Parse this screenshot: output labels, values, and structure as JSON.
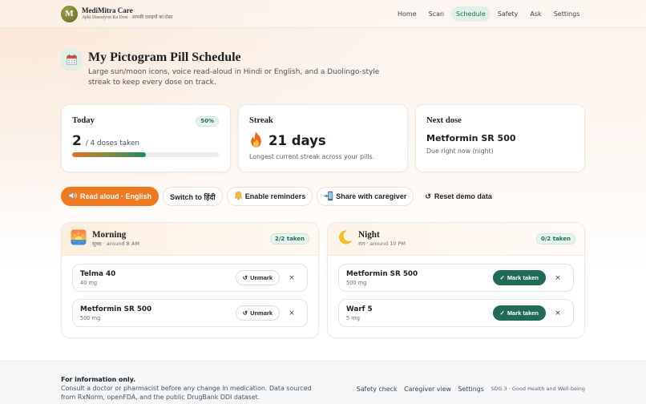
{
  "app": {
    "logo_letter": "M",
    "brand_name": "MediMitra Care",
    "brand_tagline": "Apki Dawaiyon Ka Dost · आपकी दवाइयों का दोस्त"
  },
  "nav": {
    "items": [
      {
        "label": "Home"
      },
      {
        "label": "Scan"
      },
      {
        "label": "Schedule",
        "active": true
      },
      {
        "label": "Safety"
      },
      {
        "label": "Ask"
      },
      {
        "label": "Settings"
      }
    ]
  },
  "hero": {
    "icon": "calendar-icon",
    "title": "My Pictogram Pill Schedule",
    "subtitle": "Large sun/moon icons, voice read-aloud in Hindi or English, and a Duolingo-style streak to keep every dose on track."
  },
  "stats": {
    "today": {
      "title": "Today",
      "badge": "50%",
      "taken": "2",
      "total_text": "/ 4 doses taken",
      "progress": 0.5
    },
    "streak": {
      "title": "Streak",
      "icon": "fire-icon",
      "value": "21 days",
      "caption": "Longest current streak across your pills."
    },
    "next_dose": {
      "title": "Next dose",
      "medicine": "Metformin SR 500",
      "caption": "Due right now (night)"
    }
  },
  "actions": [
    {
      "label": "Read aloud · English",
      "icon": "speaker-icon"
    },
    {
      "label": "Switch to हिंदी"
    },
    {
      "label": "Enable reminders",
      "icon": "bell-icon"
    },
    {
      "label": "Share with caregiver",
      "icon": "mobile-share-icon"
    },
    {
      "label": "Reset demo data",
      "glyph": "↺"
    }
  ],
  "schedule": {
    "morning": {
      "icon": "sunrise-icon",
      "title": "Morning",
      "subtitle": "सुबह · around 8 AM",
      "badge": "2/2 taken",
      "items": [
        {
          "name": "Telma 40",
          "dose": "40 mg",
          "taken": true,
          "action_glyph": "↺",
          "action_label": "Unmark",
          "remove_glyph": "×"
        },
        {
          "name": "Metformin SR 500",
          "dose": "500 mg",
          "taken": true,
          "action_glyph": "↺",
          "action_label": "Unmark",
          "remove_glyph": "×"
        }
      ]
    },
    "night": {
      "icon": "moon-icon",
      "title": "Night",
      "subtitle": "रात · around 10 PM",
      "badge": "0/2 taken",
      "items": [
        {
          "name": "Metformin SR 500",
          "dose": "500 mg",
          "taken": false,
          "action_glyph": "✓",
          "action_label": "Mark taken",
          "remove_glyph": "×"
        },
        {
          "name": "Warf 5",
          "dose": "5 mg",
          "taken": false,
          "action_glyph": "✓",
          "action_label": "Mark taken",
          "remove_glyph": "×"
        }
      ]
    }
  },
  "footer": {
    "heading": "For information only.",
    "text": "Consult a doctor or pharmacist before any change in medication. Data sourced from RxNorm, openFDA, and the public DrugBank DDI dataset.",
    "links": [
      "Safety check",
      "Caregiver view",
      "Settings"
    ],
    "sdg": "SDG 3 · Good Health and Well-being"
  },
  "colors": {
    "accent_orange": "#ef7a21",
    "primary_teal": "#1f6b57",
    "active_nav_bg": "#e1f0e8",
    "badge_bg": "#e6f4ee"
  }
}
